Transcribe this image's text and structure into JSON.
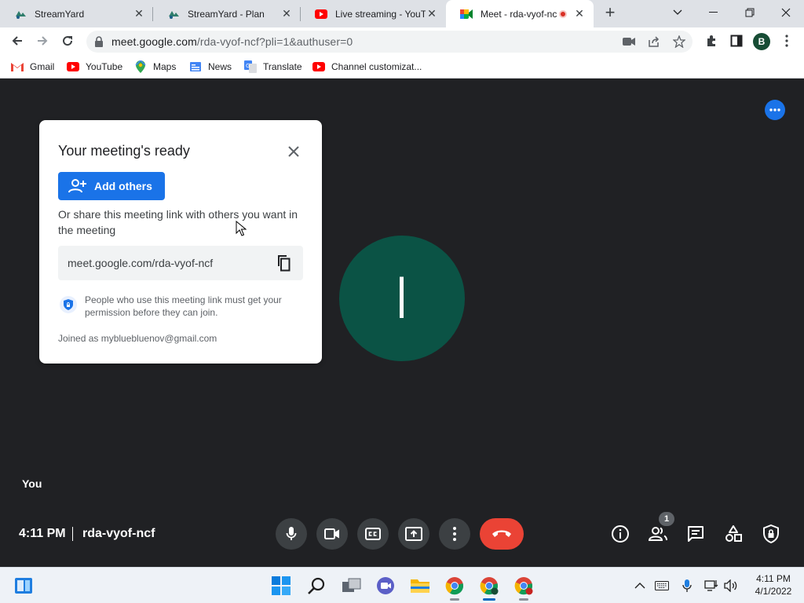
{
  "browser": {
    "tabs": [
      {
        "title": "StreamYard",
        "icon": "streamyard-icon",
        "active": false
      },
      {
        "title": "StreamYard - Plan",
        "icon": "streamyard-icon",
        "active": false
      },
      {
        "title": "Live streaming - YouTu",
        "icon": "youtube-icon",
        "active": false
      },
      {
        "title": "Meet - rda-vyof-nc",
        "icon": "google-meet-icon",
        "active": true,
        "recording": true
      }
    ],
    "url": {
      "host": "meet.google.com",
      "path": "/rda-vyof-ncf?pli=1&authuser=0"
    },
    "profile_initial": "B",
    "bookmarks": [
      {
        "label": "Gmail",
        "icon": "gmail-icon"
      },
      {
        "label": "YouTube",
        "icon": "youtube-icon"
      },
      {
        "label": "Maps",
        "icon": "maps-icon"
      },
      {
        "label": "News",
        "icon": "news-icon"
      },
      {
        "label": "Translate",
        "icon": "translate-icon"
      },
      {
        "label": "Channel customizat...",
        "icon": "youtube-icon"
      }
    ]
  },
  "meet": {
    "dialog": {
      "title": "Your meeting's ready",
      "add_others_label": "Add others",
      "share_text": "Or share this meeting link with others you want in the meeting",
      "link": "meet.google.com/rda-vyof-ncf",
      "permission_note": "People who use this meeting link must get your permission before they can join.",
      "joined_as": "Joined as mybluebluenov@gmail.com"
    },
    "avatar_initial": "I",
    "self_label": "You",
    "time": "4:11 PM",
    "meeting_code": "rda-vyof-ncf",
    "participant_count": "1",
    "colors": {
      "accent": "#1a73e8",
      "leave": "#ea4335",
      "avatar": "#0b5345",
      "stage": "#202124"
    }
  },
  "taskbar": {
    "clock_time": "4:11 PM",
    "clock_date": "4/1/2022"
  }
}
